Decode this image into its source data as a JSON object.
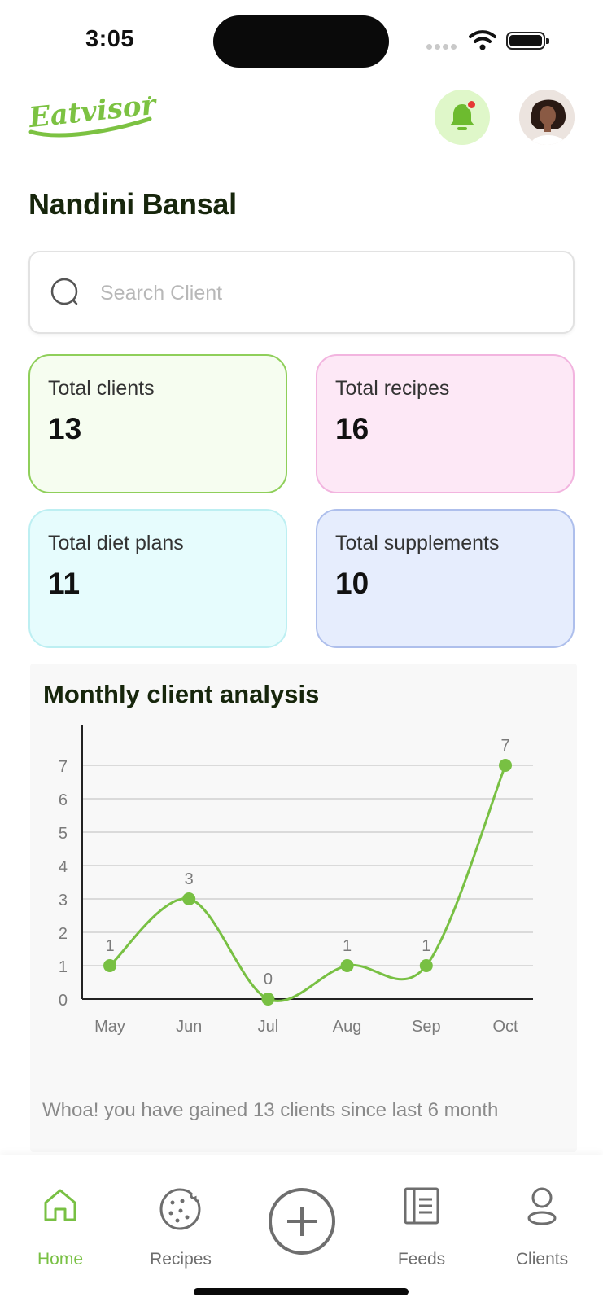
{
  "status_bar": {
    "time": "3:05"
  },
  "header": {
    "logo_text": "Eatvisor",
    "icons": {
      "notification": "bell-icon",
      "avatar": "user-avatar"
    },
    "accent_color": "#78c043"
  },
  "page": {
    "title": "Nandini Bansal"
  },
  "search": {
    "placeholder": "Search Client",
    "value": ""
  },
  "stats": [
    {
      "label": "Total clients",
      "value": "13",
      "bg": "#f6fdf0",
      "border": "#8fcf5a"
    },
    {
      "label": "Total recipes",
      "value": "16",
      "bg": "#fde8f6",
      "border": "#f2b4df"
    },
    {
      "label": "Total diet plans",
      "value": "11",
      "bg": "#e6fcfd",
      "border": "#bdeff2"
    },
    {
      "label": "Total supplements",
      "value": "10",
      "bg": "#e6edfd",
      "border": "#aebfec"
    }
  ],
  "chart_section": {
    "title": "Monthly client analysis",
    "note": "Whoa! you have gained 13 clients since last 6 month"
  },
  "chart_data": {
    "type": "line",
    "title": "Monthly client analysis",
    "x": [
      "May",
      "Jun",
      "Jul",
      "Aug",
      "Sep",
      "Oct"
    ],
    "values": [
      1,
      3,
      0,
      1,
      1,
      7
    ],
    "data_labels": [
      "1",
      "3",
      "0",
      "1",
      "1",
      "7"
    ],
    "ylim": [
      0,
      7
    ],
    "yticks": [
      "0",
      "1",
      "2",
      "3",
      "4",
      "5",
      "6",
      "7"
    ],
    "grid": true,
    "smooth": true,
    "line_color": "#78c043"
  },
  "tab_bar": {
    "items": [
      {
        "label": "Home",
        "icon": "home-icon",
        "active": true
      },
      {
        "label": "Recipes",
        "icon": "cookie-icon",
        "active": false
      },
      {
        "label": "",
        "icon": "plus-circle-icon",
        "active": false
      },
      {
        "label": "Feeds",
        "icon": "document-icon",
        "active": false
      },
      {
        "label": "Clients",
        "icon": "person-icon",
        "active": false
      }
    ]
  }
}
